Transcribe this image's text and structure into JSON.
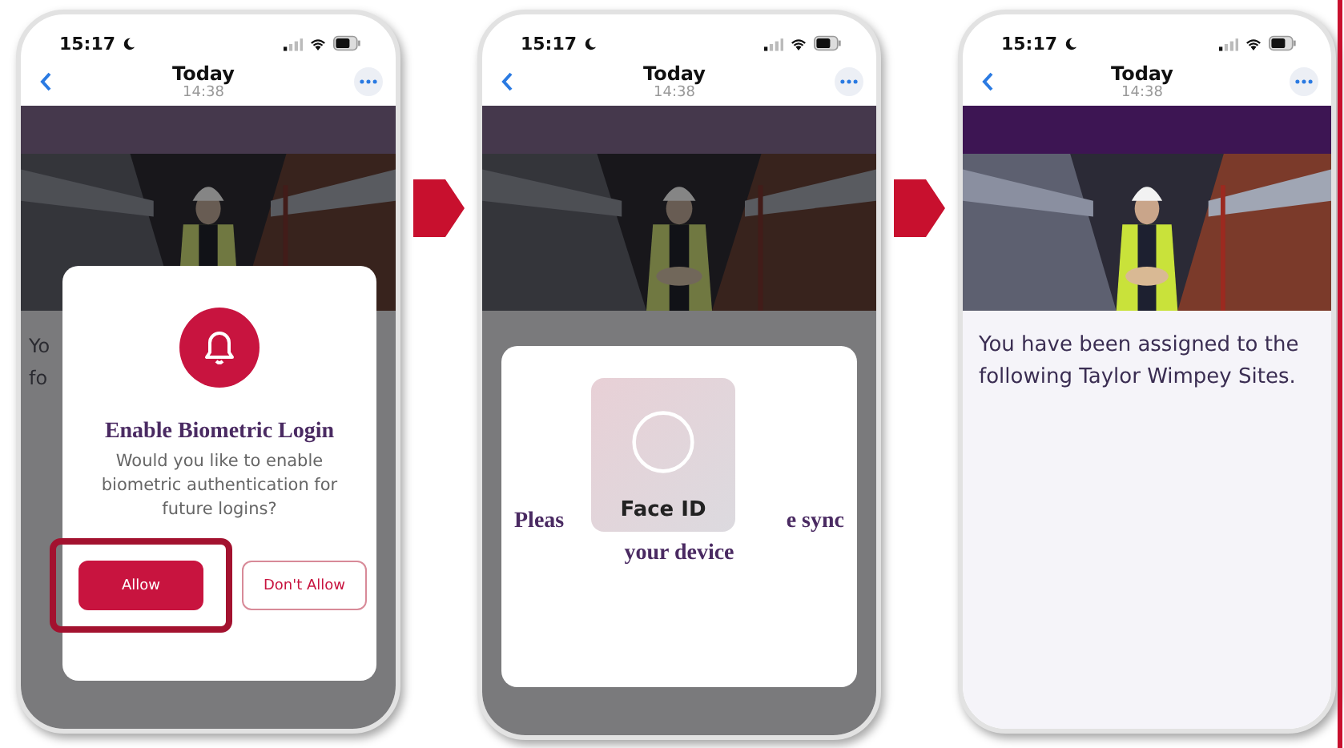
{
  "phones": [
    {
      "status_time": "15:17",
      "title": "Today",
      "subtitle": "14:38",
      "dimmed": true,
      "body_lines": [
        "Yo",
        "fo"
      ],
      "overlay": {
        "kind": "prompt",
        "title": "Enable Biometric Login",
        "message": "Would you like to enable biometric authentication for future logins?",
        "buttons": [
          {
            "label": "Allow",
            "kind": "filled",
            "highlighted": true
          },
          {
            "label": "Don't Allow",
            "kind": "outline",
            "highlighted": false
          }
        ]
      }
    },
    {
      "status_time": "15:17",
      "title": "Today",
      "subtitle": "14:38",
      "dimmed": true,
      "overlay": {
        "kind": "faceid",
        "message_parts": [
          "Pleas",
          "e sync",
          "your device"
        ],
        "label": "Face ID"
      }
    },
    {
      "status_time": "15:17",
      "title": "Today",
      "subtitle": "14:38",
      "dimmed": false,
      "body_lines": [
        "You have been assigned to the",
        "following Taylor Wimpey Sites."
      ]
    }
  ]
}
